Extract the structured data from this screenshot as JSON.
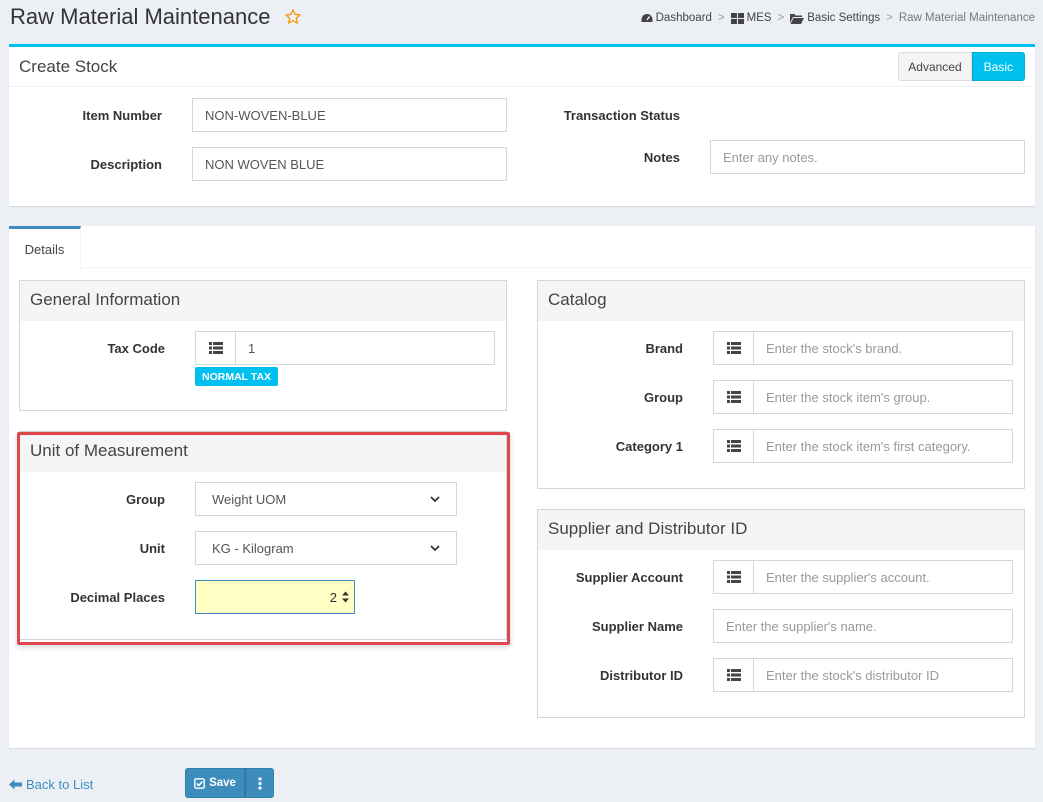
{
  "header": {
    "title": "Raw Material Maintenance",
    "breadcrumb": {
      "dashboard": "Dashboard",
      "mes": "MES",
      "basic_settings": "Basic Settings",
      "current": "Raw Material Maintenance",
      "separator": ">"
    }
  },
  "create_stock": {
    "title": "Create Stock",
    "mode_advanced": "Advanced",
    "mode_basic": "Basic",
    "item_number_label": "Item Number",
    "item_number_value": "NON-WOVEN-BLUE",
    "description_label": "Description",
    "description_value": "NON WOVEN BLUE",
    "transaction_status_label": "Transaction Status",
    "notes_label": "Notes",
    "notes_placeholder": "Enter any notes."
  },
  "tabs": {
    "details": "Details"
  },
  "general_information": {
    "title": "General Information",
    "tax_code_label": "Tax Code",
    "tax_code_value": "1",
    "tax_badge": "NORMAL TAX"
  },
  "unit_of_measurement": {
    "title": "Unit of Measurement",
    "group_label": "Group",
    "group_value": "Weight UOM",
    "unit_label": "Unit",
    "unit_value": "KG - Kilogram",
    "decimal_label": "Decimal Places",
    "decimal_value": "2"
  },
  "catalog": {
    "title": "Catalog",
    "brand_label": "Brand",
    "brand_placeholder": "Enter the stock's brand.",
    "group_label": "Group",
    "group_placeholder": "Enter the stock item's group.",
    "category_label": "Category 1",
    "category_placeholder": "Enter the stock item's first category."
  },
  "supplier": {
    "title": "Supplier and Distributor ID",
    "account_label": "Supplier Account",
    "account_placeholder": "Enter the supplier's account.",
    "name_label": "Supplier Name",
    "name_placeholder": "Enter the supplier's name.",
    "distributor_label": "Distributor ID",
    "distributor_placeholder": "Enter the stock's distributor ID"
  },
  "footer": {
    "back_label": "Back to List",
    "save_label": "Save"
  },
  "colors": {
    "accent": "#00c0ef",
    "primary": "#3c8dbc",
    "highlight": "#e0474c",
    "star": "#f39c12",
    "decimal_bg": "#ffffc4"
  },
  "icons": {
    "favorite": "star-icon",
    "dashboard": "dashboard-icon",
    "mes": "grid-icon",
    "folder": "folder-icon",
    "list": "list-icon",
    "back": "arrow-left-icon",
    "save": "check-square-icon",
    "more": "vertical-ellipsis-icon"
  }
}
